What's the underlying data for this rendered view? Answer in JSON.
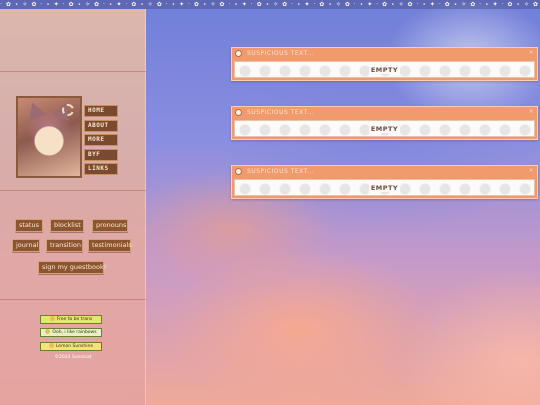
{
  "top_strip": {
    "pattern": "· ✿ ⋆ ✧ ✿ · ⋆ ✦ · ✿ ⋆ ✧ ✿ · ⋆ ✦ · ✿ ⋆ ✧ ✿ · ⋆ ✦ · ✿ ⋆ ✧ ✿ · ⋆ ✦ · ✿ ⋆ ✧ ✿ · ⋆ ✦ · ✿ ⋆ ✧ ✿ · ⋆ ✦ · ✿ ⋆ ✧ ✿ · ⋆ ✦ · ✿ ⋆ ✧ ✿ · ⋆ ✦ · ✿ ⋆ ✧ ✿ · ⋆ ✦"
  },
  "sidebar": {
    "nav": [
      {
        "label": "HOME"
      },
      {
        "label": "ABOUT"
      },
      {
        "label": "MORE"
      },
      {
        "label": "BYF"
      },
      {
        "label": "LINKS"
      }
    ],
    "links": {
      "status": "status",
      "blocklist": "blocklist",
      "pronouns": "pronouns",
      "journal": "journal",
      "transition": "transition",
      "testimonials": "testimonials",
      "guestbook": "sign my guestbook!"
    },
    "stamps": [
      {
        "text": "Free to be trans"
      },
      {
        "text": "Ooh, i like rainbows"
      },
      {
        "text": "Lemon Sunshine"
      }
    ],
    "copyright": "©2024 Sunnicat"
  },
  "widgets": [
    {
      "title": "SUSPICIOUS TEXT...",
      "body": "EMPTY"
    },
    {
      "title": "SUSPICIOUS TEXT...",
      "body": "EMPTY"
    },
    {
      "title": "SUSPICIOUS TEXT...",
      "body": "EMPTY"
    }
  ],
  "colors": {
    "accent": "#f09a6d",
    "button_bg": "#8a552f",
    "sky_top": "#6f7fd8",
    "sky_bottom": "#efa99a"
  }
}
